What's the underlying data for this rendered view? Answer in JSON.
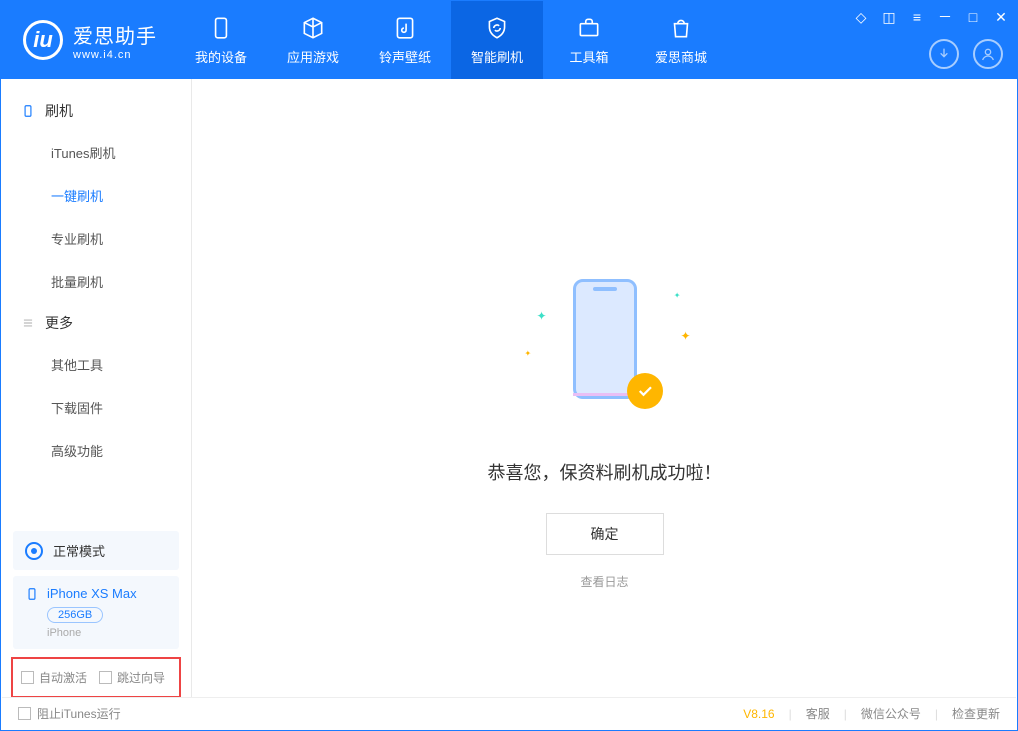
{
  "app": {
    "title": "爱思助手",
    "url": "www.i4.cn"
  },
  "nav": {
    "items": [
      {
        "label": "我的设备"
      },
      {
        "label": "应用游戏"
      },
      {
        "label": "铃声壁纸"
      },
      {
        "label": "智能刷机"
      },
      {
        "label": "工具箱"
      },
      {
        "label": "爱思商城"
      }
    ],
    "selectedIndex": 3
  },
  "sidebar": {
    "group1": {
      "title": "刷机",
      "items": [
        "iTunes刷机",
        "一键刷机",
        "专业刷机",
        "批量刷机"
      ],
      "selectedIndex": 1
    },
    "group2": {
      "title": "更多",
      "items": [
        "其他工具",
        "下载固件",
        "高级功能"
      ]
    },
    "mode": "正常模式",
    "device": {
      "name": "iPhone XS Max",
      "capacity": "256GB",
      "type": "iPhone"
    },
    "opts": {
      "autoActivate": "自动激活",
      "skipGuide": "跳过向导"
    }
  },
  "main": {
    "successMsg": "恭喜您，保资料刷机成功啦！",
    "okButton": "确定",
    "viewLog": "查看日志"
  },
  "footer": {
    "blockItunes": "阻止iTunes运行",
    "version": "V8.16",
    "links": [
      "客服",
      "微信公众号",
      "检查更新"
    ]
  }
}
